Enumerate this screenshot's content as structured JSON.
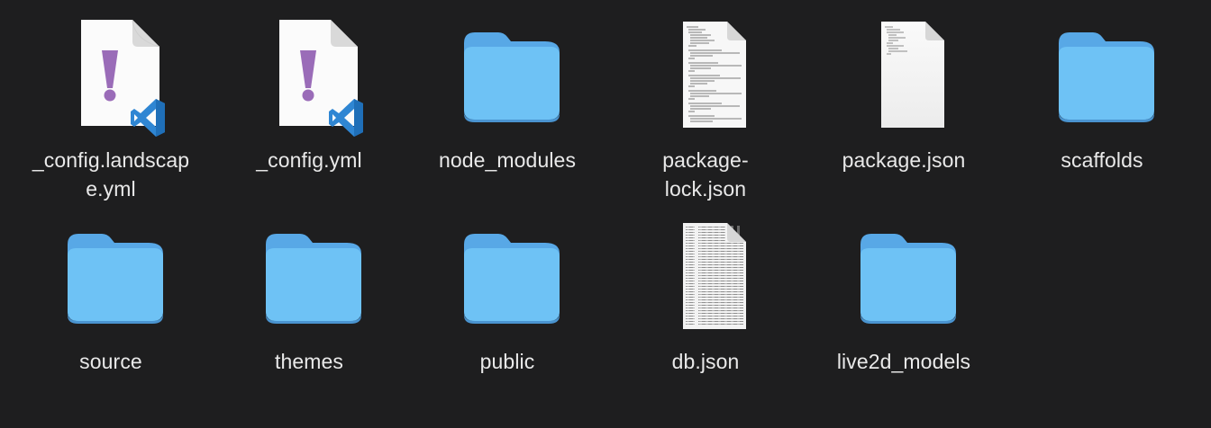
{
  "window": {
    "background": "#1e1e1f"
  },
  "colors": {
    "folder_front": "#6ec2f5",
    "folder_back": "#58a8e6",
    "label_text": "#e9e9e9",
    "yaml_bang": "#9a6cb8",
    "vscode_blue": "#2f86d3"
  },
  "items": [
    {
      "kind": "yaml-vscode",
      "icon": "yaml-file-icon",
      "name": "_config.landscape.yml",
      "lines": [
        "_config.landscap",
        "e.yml"
      ]
    },
    {
      "kind": "yaml-vscode",
      "icon": "yaml-file-icon",
      "name": "_config.yml",
      "lines": [
        "_config.yml"
      ]
    },
    {
      "kind": "folder",
      "icon": "folder-icon",
      "name": "node_modules",
      "lines": [
        "node_modules"
      ]
    },
    {
      "kind": "doc-text",
      "icon": "json-file-icon",
      "name": "package-lock.json",
      "lines": [
        "package-",
        "lock.json"
      ]
    },
    {
      "kind": "doc-sparse",
      "icon": "json-file-icon",
      "name": "package.json",
      "lines": [
        "package.json"
      ]
    },
    {
      "kind": "folder",
      "icon": "folder-icon",
      "name": "scaffolds",
      "lines": [
        "scaffolds"
      ]
    },
    {
      "kind": "folder",
      "icon": "folder-icon",
      "name": "source",
      "lines": [
        "source"
      ]
    },
    {
      "kind": "folder",
      "icon": "folder-icon",
      "name": "themes",
      "lines": [
        "themes"
      ]
    },
    {
      "kind": "folder",
      "icon": "folder-icon",
      "name": "public",
      "lines": [
        "public"
      ]
    },
    {
      "kind": "doc-dense",
      "icon": "json-file-icon",
      "name": "db.json",
      "lines": [
        "db.json"
      ]
    },
    {
      "kind": "folder",
      "icon": "folder-icon",
      "name": "live2d_models",
      "lines": [
        "live2d_models"
      ]
    }
  ]
}
